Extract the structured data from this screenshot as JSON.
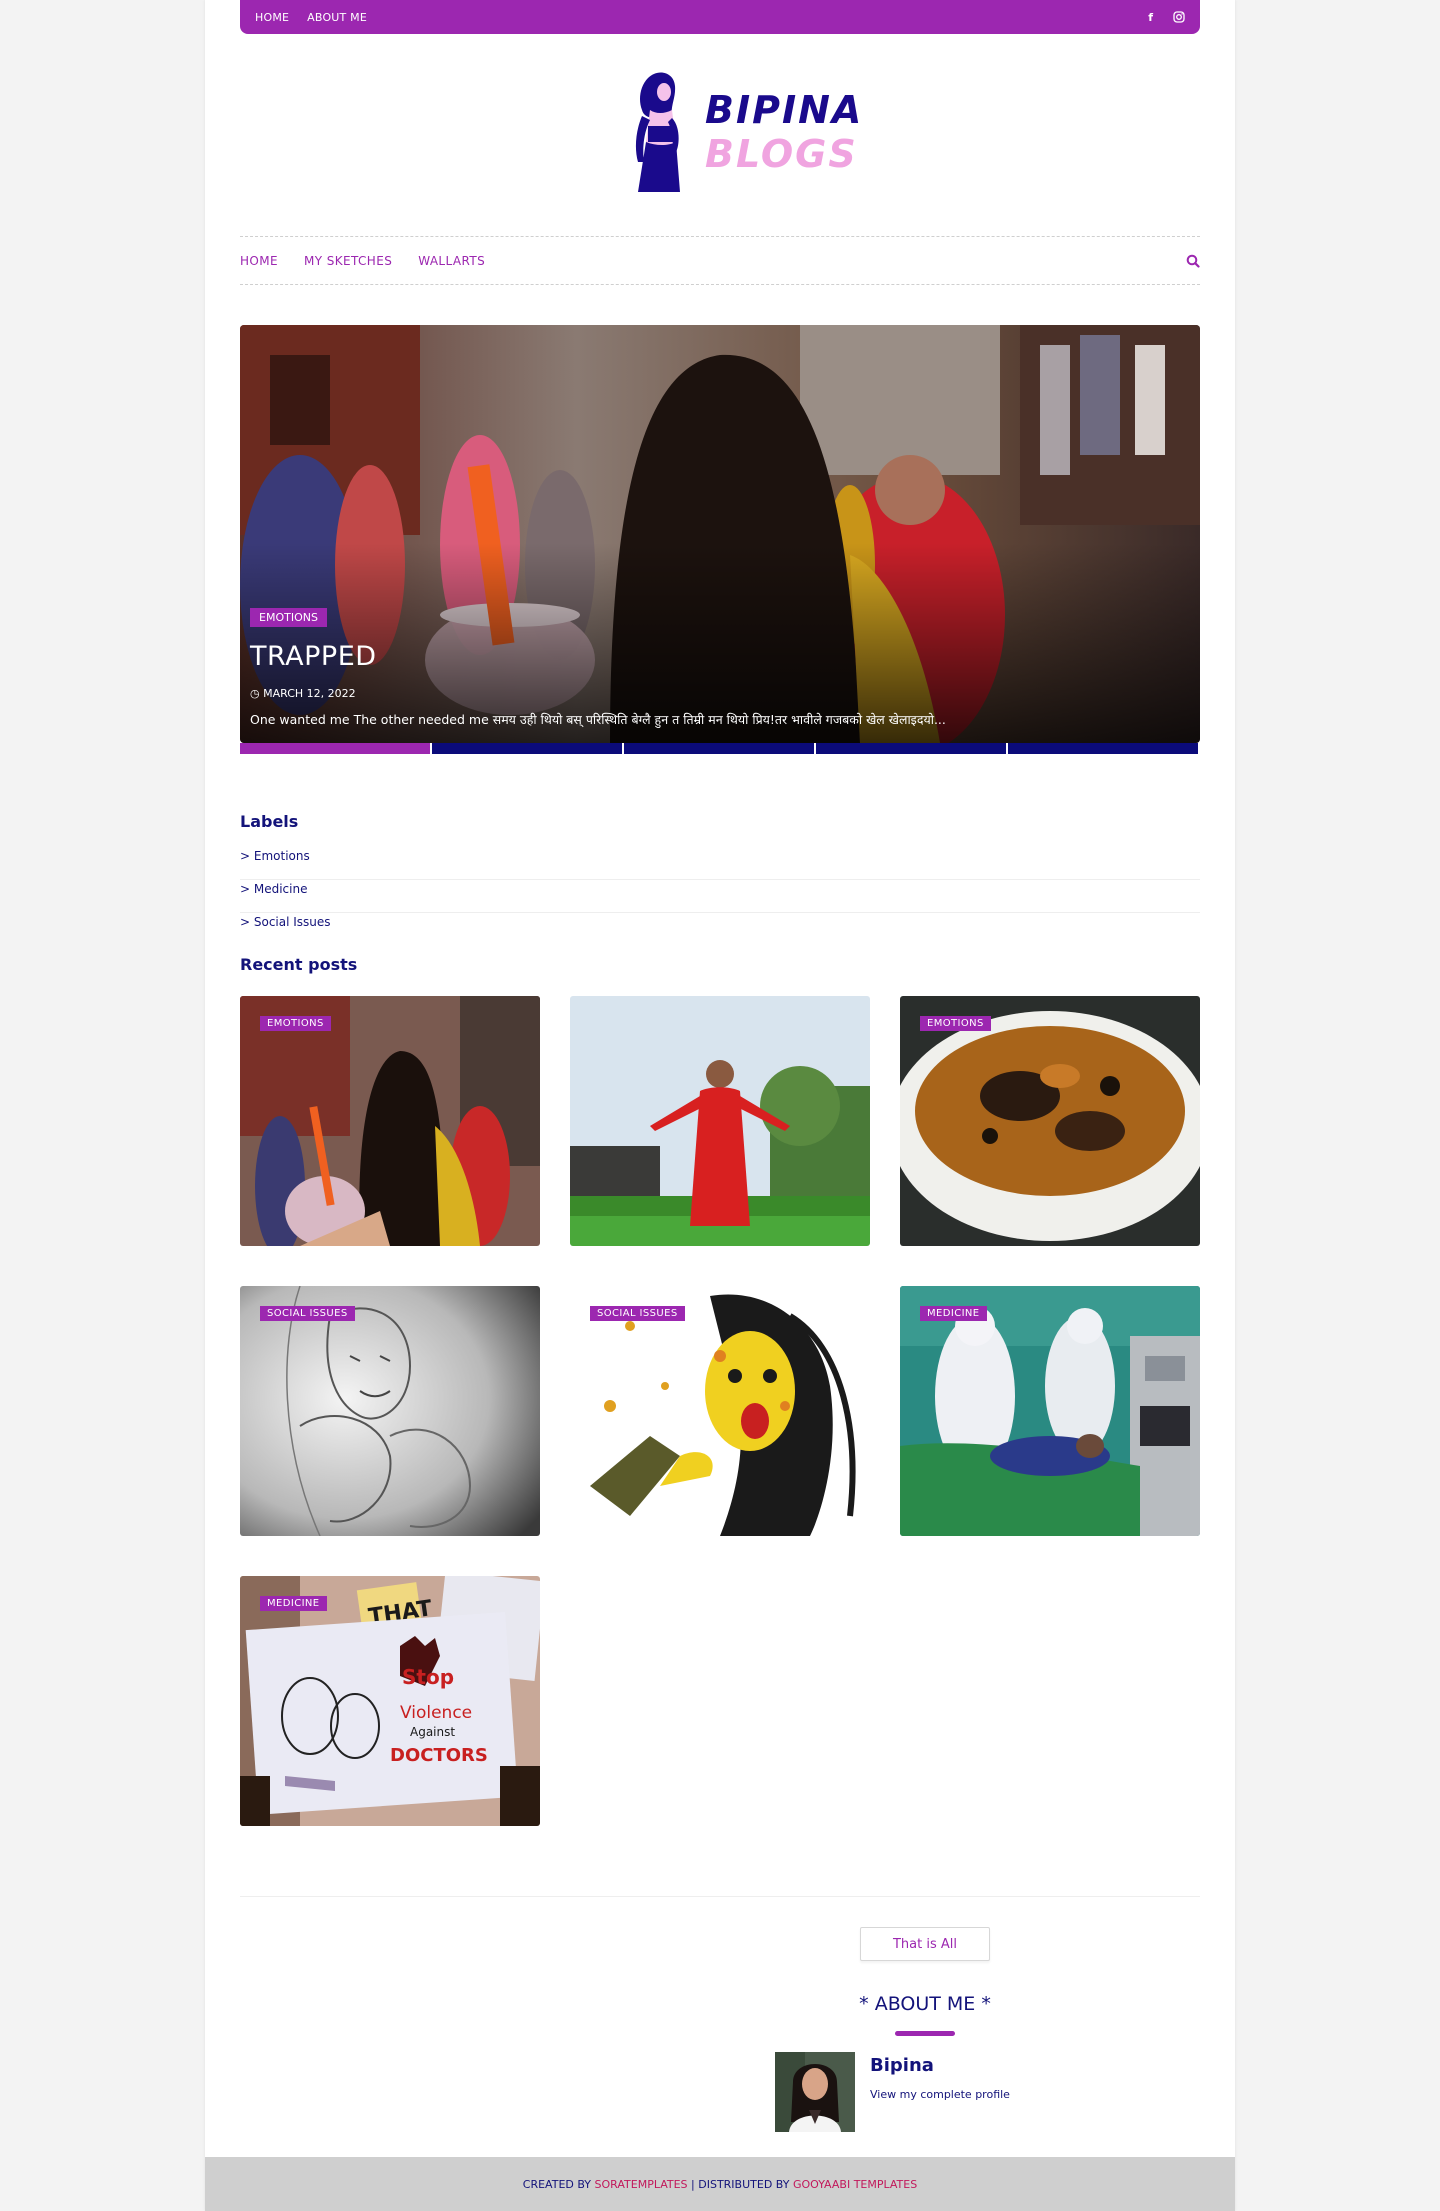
{
  "topbar": {
    "links": [
      "HOME",
      "ABOUT ME"
    ],
    "social": {
      "facebook": "f",
      "instagram": "instagram-icon"
    }
  },
  "logo": {
    "line1": "BIPINA",
    "line2": "BLOGS"
  },
  "nav": {
    "items": [
      "HOME",
      "MY SKETCHES",
      "WALLARTS"
    ]
  },
  "hero": {
    "label": "EMOTIONS",
    "title": "TRAPPED",
    "date": "MARCH 12, 2022",
    "excerpt": "One wanted me The other needed me समय उही थियो बस् परिस्थिति बेग्लै  हुन त तिम्री मन थियो प्रिय!तर भावीले गजबको खेल खेलाइदयो...",
    "slides": 5,
    "active_slide": 1
  },
  "labels": {
    "title": "Labels",
    "items": [
      "> Emotions",
      "> Medicine",
      "> Social Issues"
    ]
  },
  "recent": {
    "title": "Recent posts",
    "tags": [
      "EMOTIONS",
      "",
      "EMOTIONS",
      "SOCIAL ISSUES",
      "SOCIAL ISSUES",
      "MEDICINE",
      "MEDICINE"
    ]
  },
  "poster_text": {
    "a": "Stop",
    "b": "Violence",
    "c": "Against",
    "d": "DOCTORS",
    "e": "THAT"
  },
  "more_button": "That is All",
  "about": {
    "title": "* ABOUT ME *",
    "name": "Bipina",
    "link": "View my complete profile"
  },
  "footer": {
    "created": "CREATED BY ",
    "sora": "SORATEMPLATES",
    "distributed": " | DISTRIBUTED BY ",
    "gooyaabi": "GOOYAABI TEMPLATES"
  },
  "colors": {
    "accent": "#9c27b0",
    "navy": "#13137a",
    "pink": "#f0a4e0"
  }
}
